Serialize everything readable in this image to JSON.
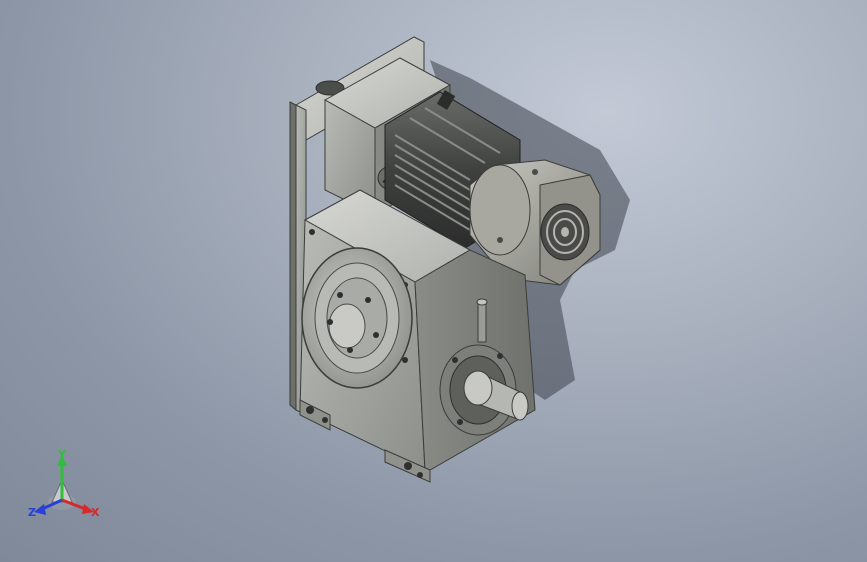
{
  "viewport": {
    "background_top": "#c3cad6",
    "background_bottom": "#7f8999"
  },
  "model": {
    "type": "gear reducer with motor",
    "body_color": "#9b9d98",
    "motor_color": "#555754",
    "fan_cover_color": "#8c8c86"
  },
  "triad": {
    "x_label": "X",
    "y_label": "Y",
    "z_label": "Z",
    "x_color": "#d42a2a",
    "y_color": "#2fbf3a",
    "z_color": "#2a3fd4"
  }
}
